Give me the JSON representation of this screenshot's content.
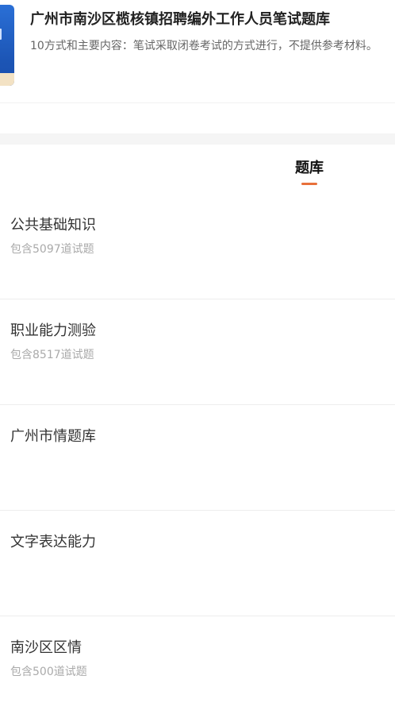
{
  "header": {
    "title": "广州市南沙区榄核镇招聘编外工作人员笔试题库",
    "description": "10方式和主要内容：笔试采取闭卷考试的方式进行，不提供参考材料。"
  },
  "tabs": [
    {
      "label": "题库",
      "active": true
    }
  ],
  "accent_color": "#e8703a",
  "items": [
    {
      "name": "公共基础知识",
      "count": "包含5097道试题"
    },
    {
      "name": "职业能力测验",
      "count": "包含8517道试题"
    },
    {
      "name": "广州市情题库",
      "count": ""
    },
    {
      "name": "文字表达能力",
      "count": ""
    },
    {
      "name": "南沙区区情",
      "count": "包含500道试题"
    }
  ]
}
